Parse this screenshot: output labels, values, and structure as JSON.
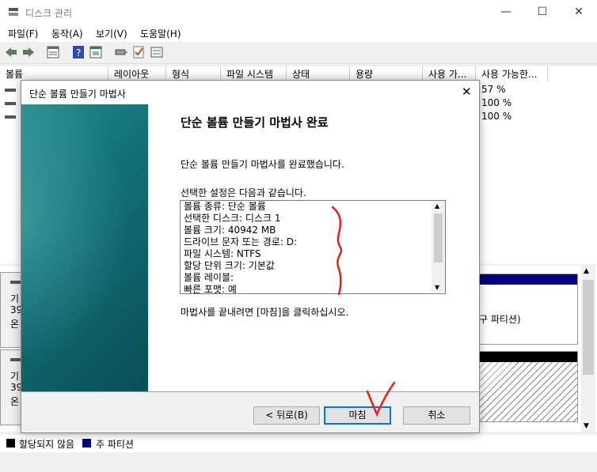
{
  "window": {
    "title": "디스크 관리",
    "controls": {
      "minimize": "—",
      "maximize": "☐",
      "close": "✕"
    }
  },
  "menu": [
    "파일(F)",
    "동작(A)",
    "보기(V)",
    "도움말(H)"
  ],
  "toolbar_icons": [
    "back-icon",
    "forward-icon",
    "list-icon",
    "help-icon",
    "properties-icon",
    "connect-icon",
    "check-icon",
    "settings-icon"
  ],
  "volume_table": {
    "columns": [
      "볼륨",
      "레이아웃",
      "형식",
      "파일 시스템",
      "상태",
      "용량",
      "사용 가...",
      "사용 가능한..."
    ],
    "free_pct": [
      "57 %",
      "100 %",
      "100 %"
    ]
  },
  "disks": [
    {
      "label_line1": "기",
      "label_line2": "39",
      "label_line3": "온"
    },
    {
      "label_line1": "기",
      "label_line2": "39",
      "label_line3": "온"
    }
  ],
  "partition_fragment": "구 파티션)",
  "legend": {
    "unallocated": "할당되지 않음",
    "primary": "주 파티션"
  },
  "dialog": {
    "title": "단순 볼륨 만들기 마법사",
    "heading": "단순 볼륨 만들기 마법사 완료",
    "completed_msg": "단순 볼륨 만들기 마법사를 완료했습니다.",
    "settings_label": "선택한 설정은 다음과 같습니다.",
    "settings": [
      "볼륨 종류: 단순 볼륨",
      "선택한 디스크: 디스크 1",
      "볼륨 크기: 40942 MB",
      "드라이브 문자 또는 경로: D:",
      "파일 시스템: NTFS",
      "할당 단위 크기: 기본값",
      "볼륨 레이블:",
      "빠른 포맷: 예"
    ],
    "finish_hint": "마법사를 끝내려면 [마침]을 클릭하십시오.",
    "buttons": {
      "back": "< 뒤로(B)",
      "finish": "마침",
      "cancel": "취소"
    },
    "close": "✕"
  },
  "colors": {
    "primary_partition": "#000080",
    "unallocated": "#000000",
    "annotation": "#e8201a",
    "wizard_teal": "#137277"
  }
}
